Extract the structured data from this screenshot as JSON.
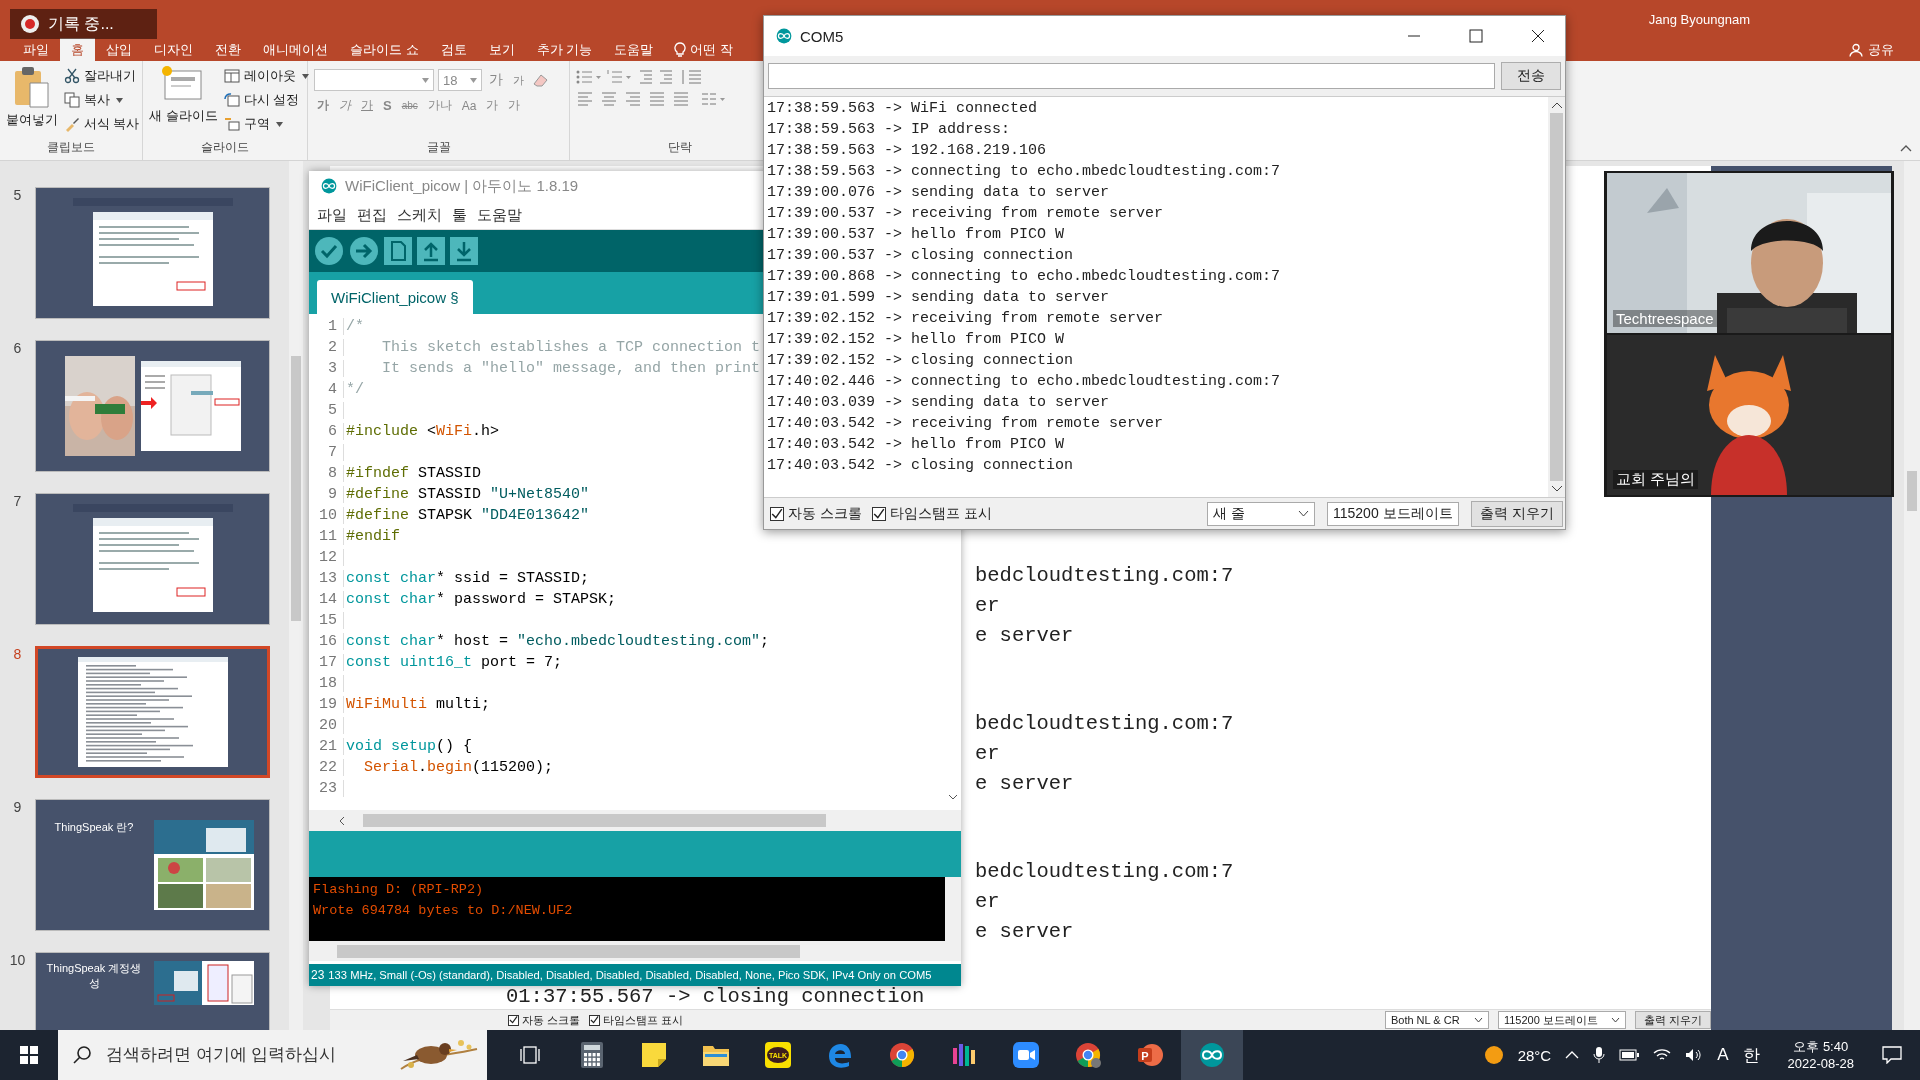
{
  "recording": {
    "label": "기록 중..."
  },
  "powerpoint": {
    "user": "Jang Byoungnam",
    "tabs": [
      {
        "label": "파일",
        "selected": false
      },
      {
        "label": "홈",
        "selected": true
      },
      {
        "label": "삽입",
        "selected": false
      },
      {
        "label": "디자인",
        "selected": false
      },
      {
        "label": "전환",
        "selected": false
      },
      {
        "label": "애니메이션",
        "selected": false
      },
      {
        "label": "슬라이드 쇼",
        "selected": false
      },
      {
        "label": "검토",
        "selected": false
      },
      {
        "label": "보기",
        "selected": false
      },
      {
        "label": "추가 기능",
        "selected": false
      },
      {
        "label": "도움말",
        "selected": false
      }
    ],
    "tell_me": "어떤 작",
    "share": "공유",
    "ribbon": {
      "clipboard": {
        "label": "클립보드",
        "big": "붙여넣기",
        "items": [
          {
            "label": "잘라내기",
            "dropdown": false
          },
          {
            "label": "복사",
            "dropdown": true
          },
          {
            "label": "서식 복사",
            "dropdown": false
          }
        ]
      },
      "slides": {
        "label": "슬라이드",
        "big": "새 슬라이드",
        "items": [
          {
            "label": "레이아웃",
            "dropdown": true
          },
          {
            "label": "다시 설정",
            "dropdown": false
          },
          {
            "label": "구역",
            "dropdown": true
          }
        ]
      },
      "font": {
        "label": "글꼴",
        "font_size": "18",
        "size_buttons": [
          "가",
          "가"
        ],
        "format_buttons": [
          "가",
          "가",
          "가",
          "S",
          "abc",
          "가나",
          "Aa",
          "가",
          "가"
        ]
      },
      "paragraph": {
        "label": "단락"
      }
    },
    "slides": [
      {
        "number": "5",
        "selected": false,
        "kind": "screenshot"
      },
      {
        "number": "6",
        "selected": false
      },
      {
        "number": "7",
        "selected": false,
        "kind": "screenshot"
      },
      {
        "number": "8",
        "selected": true,
        "kind": "log"
      },
      {
        "number": "9",
        "selected": false,
        "kind": "article",
        "title": "ThingSpeak 란?"
      },
      {
        "number": "10",
        "selected": false,
        "kind": "signup",
        "title": "ThingSpeak 계정생성"
      }
    ],
    "slide": {
      "log_blocks": [
        [
          "bedcloudtesting.com:7",
          "er",
          "e server"
        ],
        [
          "bedcloudtesting.com:7",
          "er",
          "e server"
        ],
        [
          "bedcloudtesting.com:7",
          "er",
          "e server"
        ]
      ],
      "last_line": "01:37:55.567 -> closing connection",
      "options": [
        {
          "label": "자동 스크롤",
          "checked": true
        },
        {
          "label": "타임스탬프 표시",
          "checked": true
        }
      ],
      "line_ending": "Both NL & CR",
      "baud": "115200 보드레이트",
      "clear": "출력 지우기"
    }
  },
  "arduino": {
    "title": "WiFiClient_picow | 아두이노 1.8.19",
    "menu": [
      "파일",
      "편집",
      "스케치",
      "툴",
      "도움말"
    ],
    "tab": "WiFiClient_picow §",
    "code": [
      {
        "number": "1",
        "tokens": [
          {
            "text": "/*",
            "kind": "comment"
          }
        ]
      },
      {
        "number": "2",
        "tokens": [
          {
            "text": "    This sketch establishes a TCP connection t",
            "kind": "comment"
          }
        ]
      },
      {
        "number": "3",
        "tokens": [
          {
            "text": "    It sends a \"hello\" message, and then print",
            "kind": "comment"
          }
        ]
      },
      {
        "number": "4",
        "tokens": [
          {
            "text": "*/",
            "kind": "comment"
          }
        ]
      },
      {
        "number": "5"
      },
      {
        "number": "6",
        "tokens": [
          {
            "text": "#include",
            "kind": "preproc"
          },
          {
            "text": " <",
            "kind": "plain"
          },
          {
            "text": "WiFi",
            "kind": "library"
          },
          {
            "text": ".h>",
            "kind": "plain"
          }
        ]
      },
      {
        "number": "7"
      },
      {
        "number": "8",
        "tokens": [
          {
            "text": "#ifndef",
            "kind": "preproc"
          },
          {
            "text": " STASSID",
            "kind": "plain"
          }
        ]
      },
      {
        "number": "9",
        "tokens": [
          {
            "text": "#define",
            "kind": "preproc"
          },
          {
            "text": " STASSID ",
            "kind": "plain"
          },
          {
            "text": "\"U+Net8540\"",
            "kind": "string"
          }
        ]
      },
      {
        "number": "10",
        "tokens": [
          {
            "text": "#define",
            "kind": "preproc"
          },
          {
            "text": " STAPSK ",
            "kind": "plain"
          },
          {
            "text": "\"DD4E013642\"",
            "kind": "string"
          }
        ]
      },
      {
        "number": "11",
        "tokens": [
          {
            "text": "#endif",
            "kind": "preproc"
          }
        ]
      },
      {
        "number": "12"
      },
      {
        "number": "13",
        "tokens": [
          {
            "text": "const char",
            "kind": "keyword"
          },
          {
            "text": "* ssid = STASSID;",
            "kind": "plain"
          }
        ]
      },
      {
        "number": "14",
        "tokens": [
          {
            "text": "const char",
            "kind": "keyword"
          },
          {
            "text": "* password = STAPSK;",
            "kind": "plain"
          }
        ]
      },
      {
        "number": "15"
      },
      {
        "number": "16",
        "tokens": [
          {
            "text": "const char",
            "kind": "keyword"
          },
          {
            "text": "* host = ",
            "kind": "plain"
          },
          {
            "text": "\"echo.mbedcloudtesting.com\"",
            "kind": "string"
          },
          {
            "text": ";",
            "kind": "plain"
          }
        ]
      },
      {
        "number": "17",
        "tokens": [
          {
            "text": "const uint16_t",
            "kind": "keyword"
          },
          {
            "text": " port = 7;",
            "kind": "plain"
          }
        ]
      },
      {
        "number": "18"
      },
      {
        "number": "19",
        "tokens": [
          {
            "text": "WiFiMulti",
            "kind": "library"
          },
          {
            "text": " multi;",
            "kind": "plain"
          }
        ]
      },
      {
        "number": "20"
      },
      {
        "number": "21",
        "tokens": [
          {
            "text": "void setup",
            "kind": "keyword"
          },
          {
            "text": "() {",
            "kind": "plain"
          }
        ]
      },
      {
        "number": "22",
        "tokens": [
          {
            "text": "  Serial",
            "kind": "library"
          },
          {
            "text": ".",
            "kind": "plain"
          },
          {
            "text": "begin",
            "kind": "library"
          },
          {
            "text": "(115200);",
            "kind": "plain"
          }
        ]
      },
      {
        "number": "23"
      }
    ],
    "console": [
      "Flashing D: (RPI-RP2)",
      "Wrote 694784 bytes to D:/NEW.UF2"
    ],
    "status_line": "23",
    "status": "133 MHz, Small (-Os) (standard), Disabled, Disabled, Disabled, Disabled, Disabled, None, Pico SDK, IPv4 Only on COM5"
  },
  "serial_monitor": {
    "title": "COM5",
    "send": "전송",
    "lines": [
      "17:38:59.563 -> WiFi connected",
      "17:38:59.563 -> IP address:",
      "17:38:59.563 -> 192.168.219.106",
      "17:38:59.563 -> connecting to echo.mbedcloudtesting.com:7",
      "17:39:00.076 -> sending data to server",
      "17:39:00.537 -> receiving from remote server",
      "17:39:00.537 -> hello from PICO W",
      "17:39:00.537 -> closing connection",
      "17:39:00.868 -> connecting to echo.mbedcloudtesting.com:7",
      "17:39:01.599 -> sending data to server",
      "17:39:02.152 -> receiving from remote server",
      "17:39:02.152 -> hello from PICO W",
      "17:39:02.152 -> closing connection",
      "17:40:02.446 -> connecting to echo.mbedcloudtesting.com:7",
      "17:40:03.039 -> sending data to server",
      "17:40:03.542 -> receiving from remote server",
      "17:40:03.542 -> hello from PICO W",
      "17:40:03.542 -> closing connection"
    ],
    "options": [
      {
        "label": "자동 스크롤",
        "checked": true
      },
      {
        "label": "타임스탬프 표시",
        "checked": true
      }
    ],
    "line_ending": "새 줄",
    "baud": "115200 보드레이트",
    "clear": "출력 지우기"
  },
  "video_call": {
    "participants": [
      {
        "name": "Techtreespace",
        "kind": "camera"
      },
      {
        "name": "교회 주님의",
        "kind": "avatar"
      }
    ]
  },
  "taskbar": {
    "search_placeholder": "검색하려면 여기에 입력하십시",
    "apps": [
      {
        "kind": "task-view",
        "selected": false
      },
      {
        "kind": "calculator",
        "selected": false
      },
      {
        "kind": "notes",
        "selected": false
      },
      {
        "kind": "explorer",
        "selected": false
      },
      {
        "kind": "chat",
        "label": "TALK",
        "selected": false
      },
      {
        "kind": "edge",
        "selected": false
      },
      {
        "kind": "chrome",
        "selected": false
      },
      {
        "kind": "bars",
        "selected": false
      },
      {
        "kind": "zoom",
        "selected": false
      },
      {
        "kind": "chrome-profile",
        "selected": false
      },
      {
        "kind": "powerpoint",
        "label": "P",
        "selected": false
      },
      {
        "kind": "arduino",
        "selected": true
      }
    ],
    "weather": "28°C",
    "input_mode": "A",
    "ime": "한",
    "time": "오후 5:40",
    "date": "2022-08-28"
  }
}
